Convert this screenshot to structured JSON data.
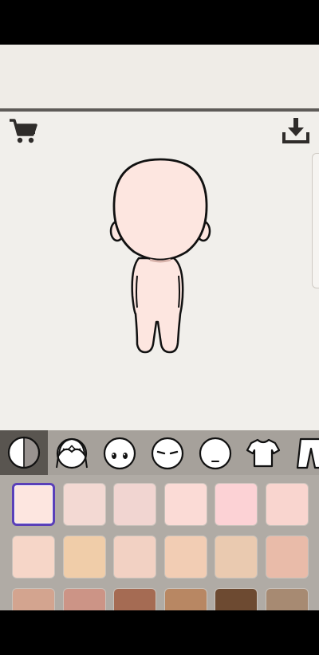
{
  "toolbar": {
    "cart_icon": "shopping-cart-icon",
    "download_icon": "download-icon"
  },
  "character": {
    "skin_color": "#fde6e0",
    "outline_color": "#111111"
  },
  "category_tabs": [
    {
      "name": "skin-color",
      "icon": "half-shaded-face-icon",
      "active": true
    },
    {
      "name": "hair",
      "icon": "hair-icon",
      "active": false
    },
    {
      "name": "eyes",
      "icon": "eyes-icon",
      "active": false
    },
    {
      "name": "eyebrows",
      "icon": "eyebrows-icon",
      "active": false
    },
    {
      "name": "mouth",
      "icon": "mouth-icon",
      "active": false
    },
    {
      "name": "shirt",
      "icon": "shirt-icon",
      "active": false
    },
    {
      "name": "pants",
      "icon": "pants-icon",
      "active": false
    }
  ],
  "skin_swatches": [
    {
      "color": "#fde6e0",
      "selected": true
    },
    {
      "color": "#f3d9d3",
      "selected": false
    },
    {
      "color": "#f1d5d1",
      "selected": false
    },
    {
      "color": "#fbdbd6",
      "selected": false
    },
    {
      "color": "#fcd2d5",
      "selected": false
    },
    {
      "color": "#f9d5cf",
      "selected": false
    },
    {
      "color": "#f6d6c8",
      "selected": false
    },
    {
      "color": "#f0cda9",
      "selected": false
    },
    {
      "color": "#f2d1c3",
      "selected": false
    },
    {
      "color": "#f2cdb4",
      "selected": false
    },
    {
      "color": "#eacab0",
      "selected": false
    },
    {
      "color": "#e9bba9",
      "selected": false
    },
    {
      "color": "#d3a48f",
      "selected": false
    },
    {
      "color": "#cc9486",
      "selected": false
    },
    {
      "color": "#a56b53",
      "selected": false
    },
    {
      "color": "#b88763",
      "selected": false
    },
    {
      "color": "#6d4a31",
      "selected": false
    },
    {
      "color": "#a78a72",
      "selected": false
    }
  ]
}
